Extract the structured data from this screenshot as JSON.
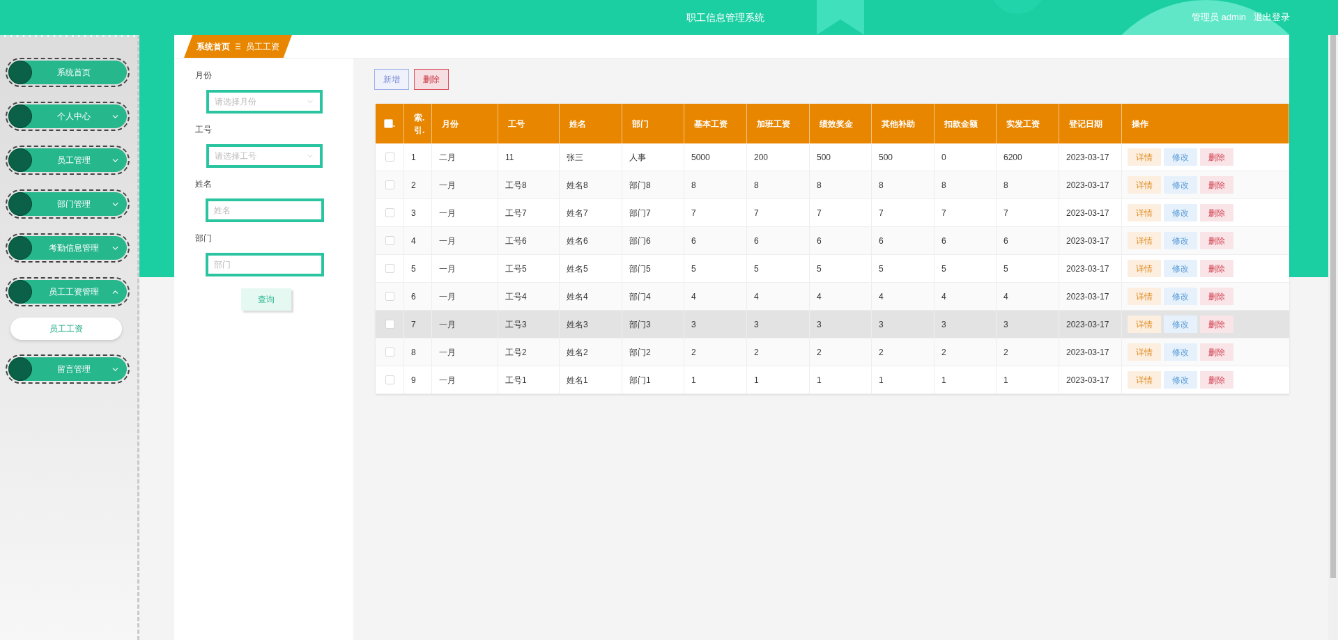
{
  "header": {
    "title": "职工信息管理系统",
    "user": "管理员 admin",
    "logout": "退出登录"
  },
  "sidebar": {
    "items": [
      {
        "label": "系统首页",
        "kind": "link"
      },
      {
        "label": "个人中心",
        "kind": "menu",
        "expanded": false
      },
      {
        "label": "员工管理",
        "kind": "menu",
        "expanded": false
      },
      {
        "label": "部门管理",
        "kind": "menu",
        "expanded": false
      },
      {
        "label": "考勤信息管理",
        "kind": "menu",
        "expanded": false
      },
      {
        "label": "员工工资管理",
        "kind": "menu",
        "expanded": true,
        "children": [
          {
            "label": "员工工资",
            "selected": true
          }
        ]
      },
      {
        "label": "留言管理",
        "kind": "menu",
        "expanded": false
      }
    ]
  },
  "breadcrumb": [
    "系统首页",
    "员工工资"
  ],
  "filters": [
    {
      "label": "月份",
      "placeholder": "请选择月份",
      "kind": "select"
    },
    {
      "label": "工号",
      "placeholder": "请选择工号",
      "kind": "select"
    },
    {
      "label": "姓名",
      "placeholder": "姓名",
      "kind": "input"
    },
    {
      "label": "部门",
      "placeholder": "部门",
      "kind": "input"
    }
  ],
  "search_button": "查询",
  "toolbar": [
    {
      "label": "新增",
      "kind": "add"
    },
    {
      "label": "删除",
      "kind": "delete"
    }
  ],
  "table": {
    "select_all": {
      "label": ".",
      "checked": false
    },
    "columns": [
      "索.引.",
      "月份",
      "工号",
      "姓名",
      "部门",
      "基本工资",
      "加班工资",
      "绩效奖金",
      "其他补助",
      "扣款金额",
      "实发工资",
      "登记日期",
      "操作"
    ],
    "rows": [
      {
        "checked": false,
        "highlighted": false,
        "cells": [
          "1",
          "二月",
          "11",
          "张三",
          "人事",
          "5000",
          "200",
          "500",
          "500",
          "0",
          "6200",
          "2023-03-17"
        ],
        "actions": [
          "详情",
          "修改",
          "删除"
        ]
      },
      {
        "checked": false,
        "highlighted": false,
        "cells": [
          "2",
          "一月",
          "工号8",
          "姓名8",
          "部门8",
          "8",
          "8",
          "8",
          "8",
          "8",
          "8",
          "2023-03-17"
        ],
        "actions": [
          "详情",
          "修改",
          "删除"
        ]
      },
      {
        "checked": false,
        "highlighted": false,
        "cells": [
          "3",
          "一月",
          "工号7",
          "姓名7",
          "部门7",
          "7",
          "7",
          "7",
          "7",
          "7",
          "7",
          "2023-03-17"
        ],
        "actions": [
          "详情",
          "修改",
          "删除"
        ]
      },
      {
        "checked": false,
        "highlighted": false,
        "cells": [
          "4",
          "一月",
          "工号6",
          "姓名6",
          "部门6",
          "6",
          "6",
          "6",
          "6",
          "6",
          "6",
          "2023-03-17"
        ],
        "actions": [
          "详情",
          "修改",
          "删除"
        ]
      },
      {
        "checked": false,
        "highlighted": false,
        "cells": [
          "5",
          "一月",
          "工号5",
          "姓名5",
          "部门5",
          "5",
          "5",
          "5",
          "5",
          "5",
          "5",
          "2023-03-17"
        ],
        "actions": [
          "详情",
          "修改",
          "删除"
        ]
      },
      {
        "checked": false,
        "highlighted": false,
        "cells": [
          "6",
          "一月",
          "工号4",
          "姓名4",
          "部门4",
          "4",
          "4",
          "4",
          "4",
          "4",
          "4",
          "2023-03-17"
        ],
        "actions": [
          "详情",
          "修改",
          "删除"
        ]
      },
      {
        "checked": false,
        "highlighted": true,
        "cells": [
          "7",
          "一月",
          "工号3",
          "姓名3",
          "部门3",
          "3",
          "3",
          "3",
          "3",
          "3",
          "3",
          "2023-03-17"
        ],
        "actions": [
          "详情",
          "修改",
          "删除"
        ]
      },
      {
        "checked": false,
        "highlighted": false,
        "cells": [
          "8",
          "一月",
          "工号2",
          "姓名2",
          "部门2",
          "2",
          "2",
          "2",
          "2",
          "2",
          "2",
          "2023-03-17"
        ],
        "actions": [
          "详情",
          "修改",
          "删除"
        ]
      },
      {
        "checked": false,
        "highlighted": false,
        "cells": [
          "9",
          "一月",
          "工号1",
          "姓名1",
          "部门1",
          "1",
          "1",
          "1",
          "1",
          "1",
          "1",
          "2023-03-17"
        ],
        "actions": [
          "详情",
          "修改",
          "删除"
        ]
      }
    ]
  }
}
